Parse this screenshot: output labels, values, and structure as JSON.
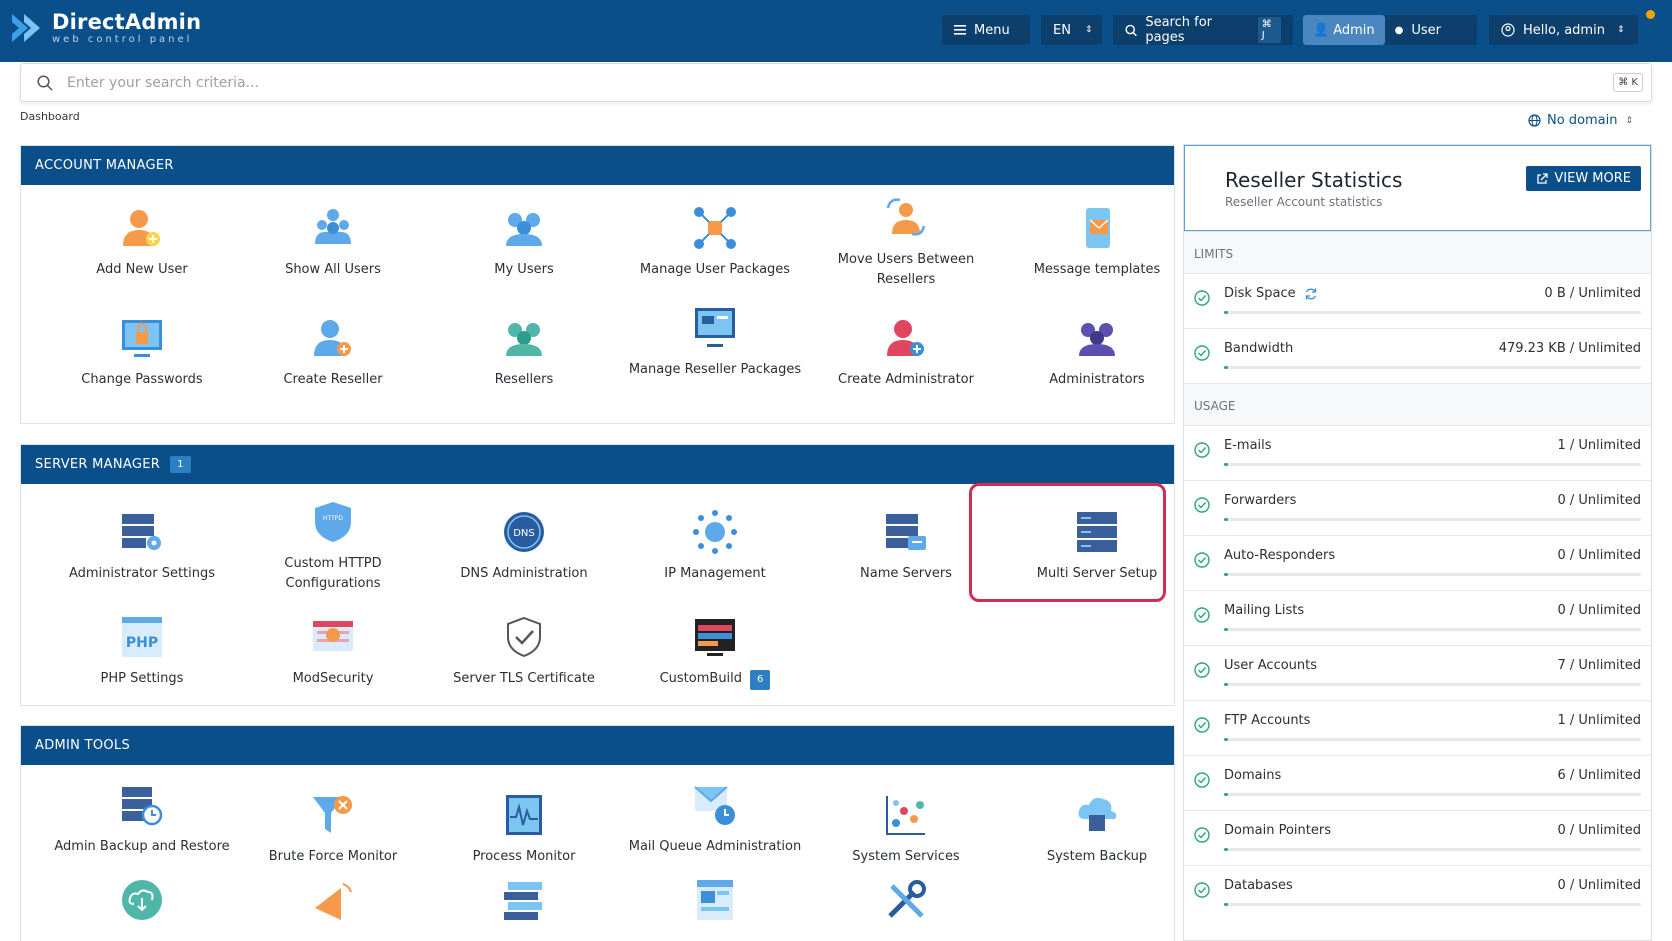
{
  "topbar": {
    "brand": "DirectAdmin",
    "tagline": "web control panel",
    "menu_label": "Menu",
    "language": "EN",
    "search_label": "Search for pages",
    "search_shortcut": "⌘ J",
    "role_admin": "Admin",
    "role_user": "User",
    "greeting": "Hello, admin"
  },
  "search": {
    "placeholder": "Enter your search criteria...",
    "shortcut": "⌘ K"
  },
  "breadcrumb": "Dashboard",
  "domain_selector": "No domain",
  "account_manager": {
    "title": "ACCOUNT MANAGER",
    "items": [
      "Add New User",
      "Show All Users",
      "My Users",
      "Manage User Packages",
      "Move Users Between Resellers",
      "Message templates",
      "Change Passwords",
      "Create Reseller",
      "Resellers",
      "Manage Reseller Packages",
      "Create Administrator",
      "Administrators"
    ]
  },
  "server_manager": {
    "title": "SERVER MANAGER",
    "badge": "1",
    "items": [
      "Administrator Settings",
      "Custom HTTPD Configurations",
      "DNS Administration",
      "IP Management",
      "Name Servers",
      "Multi Server Setup",
      "PHP Settings",
      "ModSecurity",
      "Server TLS Certificate",
      "CustomBuild"
    ],
    "custombuild_badge": "6"
  },
  "admin_tools": {
    "title": "ADMIN TOOLS",
    "items": [
      "Admin Backup and Restore",
      "Brute Force Monitor",
      "Process Monitor",
      "Mail Queue Administration",
      "System Services",
      "System Backup"
    ]
  },
  "reseller_stats": {
    "title": "Reseller Statistics",
    "subtitle": "Reseller Account statistics",
    "view_more": "VIEW MORE",
    "limits_label": "LIMITS",
    "usage_label": "USAGE",
    "limits": [
      {
        "label": "Disk Space",
        "value": "0 B / Unlimited"
      },
      {
        "label": "Bandwidth",
        "value": "479.23 KB / Unlimited"
      }
    ],
    "usage": [
      {
        "label": "E-mails",
        "value": "1 / Unlimited"
      },
      {
        "label": "Forwarders",
        "value": "0 / Unlimited"
      },
      {
        "label": "Auto-Responders",
        "value": "0 / Unlimited"
      },
      {
        "label": "Mailing Lists",
        "value": "0 / Unlimited"
      },
      {
        "label": "User Accounts",
        "value": "7 / Unlimited"
      },
      {
        "label": "FTP Accounts",
        "value": "1 / Unlimited"
      },
      {
        "label": "Domains",
        "value": "6 / Unlimited"
      },
      {
        "label": "Domain Pointers",
        "value": "0 / Unlimited"
      },
      {
        "label": "Databases",
        "value": "0 / Unlimited"
      }
    ]
  },
  "colors": {
    "header": "#0a4f8a",
    "accent": "#2d7fc1",
    "highlight": "#d02d53",
    "progress": "#2aa874"
  }
}
